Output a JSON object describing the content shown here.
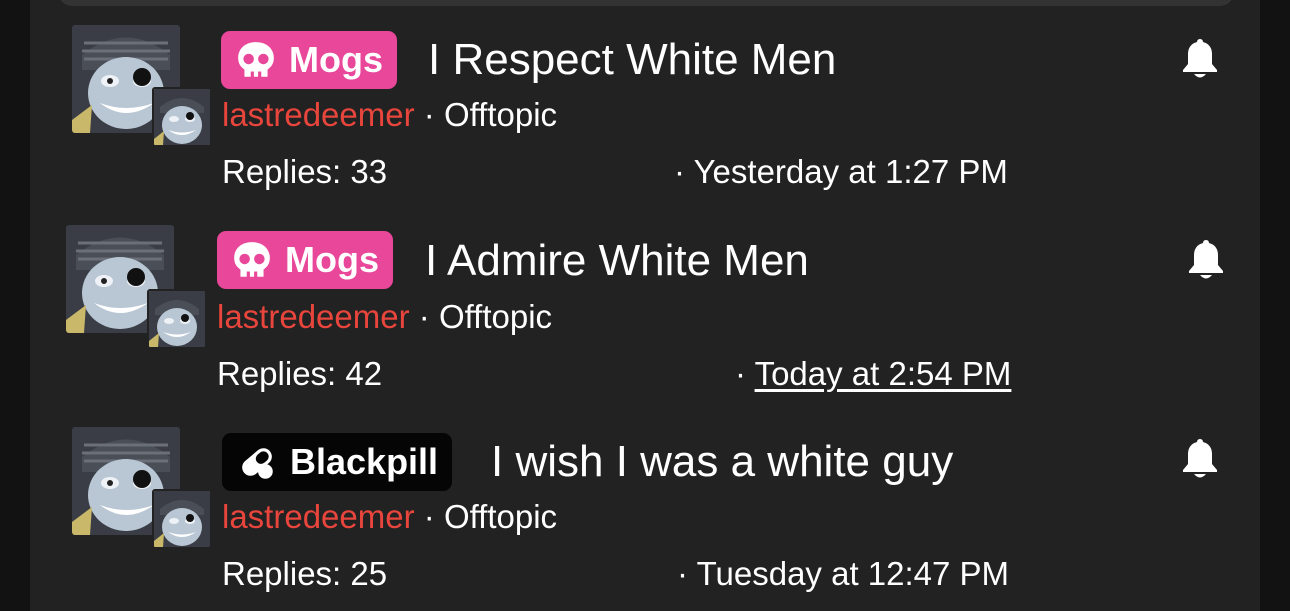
{
  "colors": {
    "background": "#222223",
    "author": "#e8453c",
    "mogs_prefix": "#e8479a",
    "blackpill_prefix": "#050505",
    "text": "#ffffff"
  },
  "threads": [
    {
      "prefix": {
        "label": "Mogs",
        "icon": "skull-icon",
        "style": "mogs"
      },
      "title": "I Respect White Men",
      "author": "lastredeemer",
      "forum": "Offtopic",
      "separator": "·",
      "replies": "Replies: 33",
      "date": "Yesterday at 1:27 PM",
      "date_underlined": false,
      "watch_icon": "bell-icon"
    },
    {
      "prefix": {
        "label": "Mogs",
        "icon": "skull-icon",
        "style": "mogs"
      },
      "title": "I Admire White Men",
      "author": "lastredeemer",
      "forum": "Offtopic",
      "separator": "·",
      "replies": "Replies: 42",
      "date": "Today at 2:54 PM",
      "date_underlined": true,
      "watch_icon": "bell-icon"
    },
    {
      "prefix": {
        "label": "Blackpill",
        "icon": "pills-icon",
        "style": "blackpill"
      },
      "title": "I wish I was a white guy",
      "author": "lastredeemer",
      "forum": "Offtopic",
      "separator": "·",
      "replies": "Replies: 25",
      "date": "Tuesday at 12:47 PM",
      "date_underlined": false,
      "watch_icon": "bell-icon"
    }
  ]
}
